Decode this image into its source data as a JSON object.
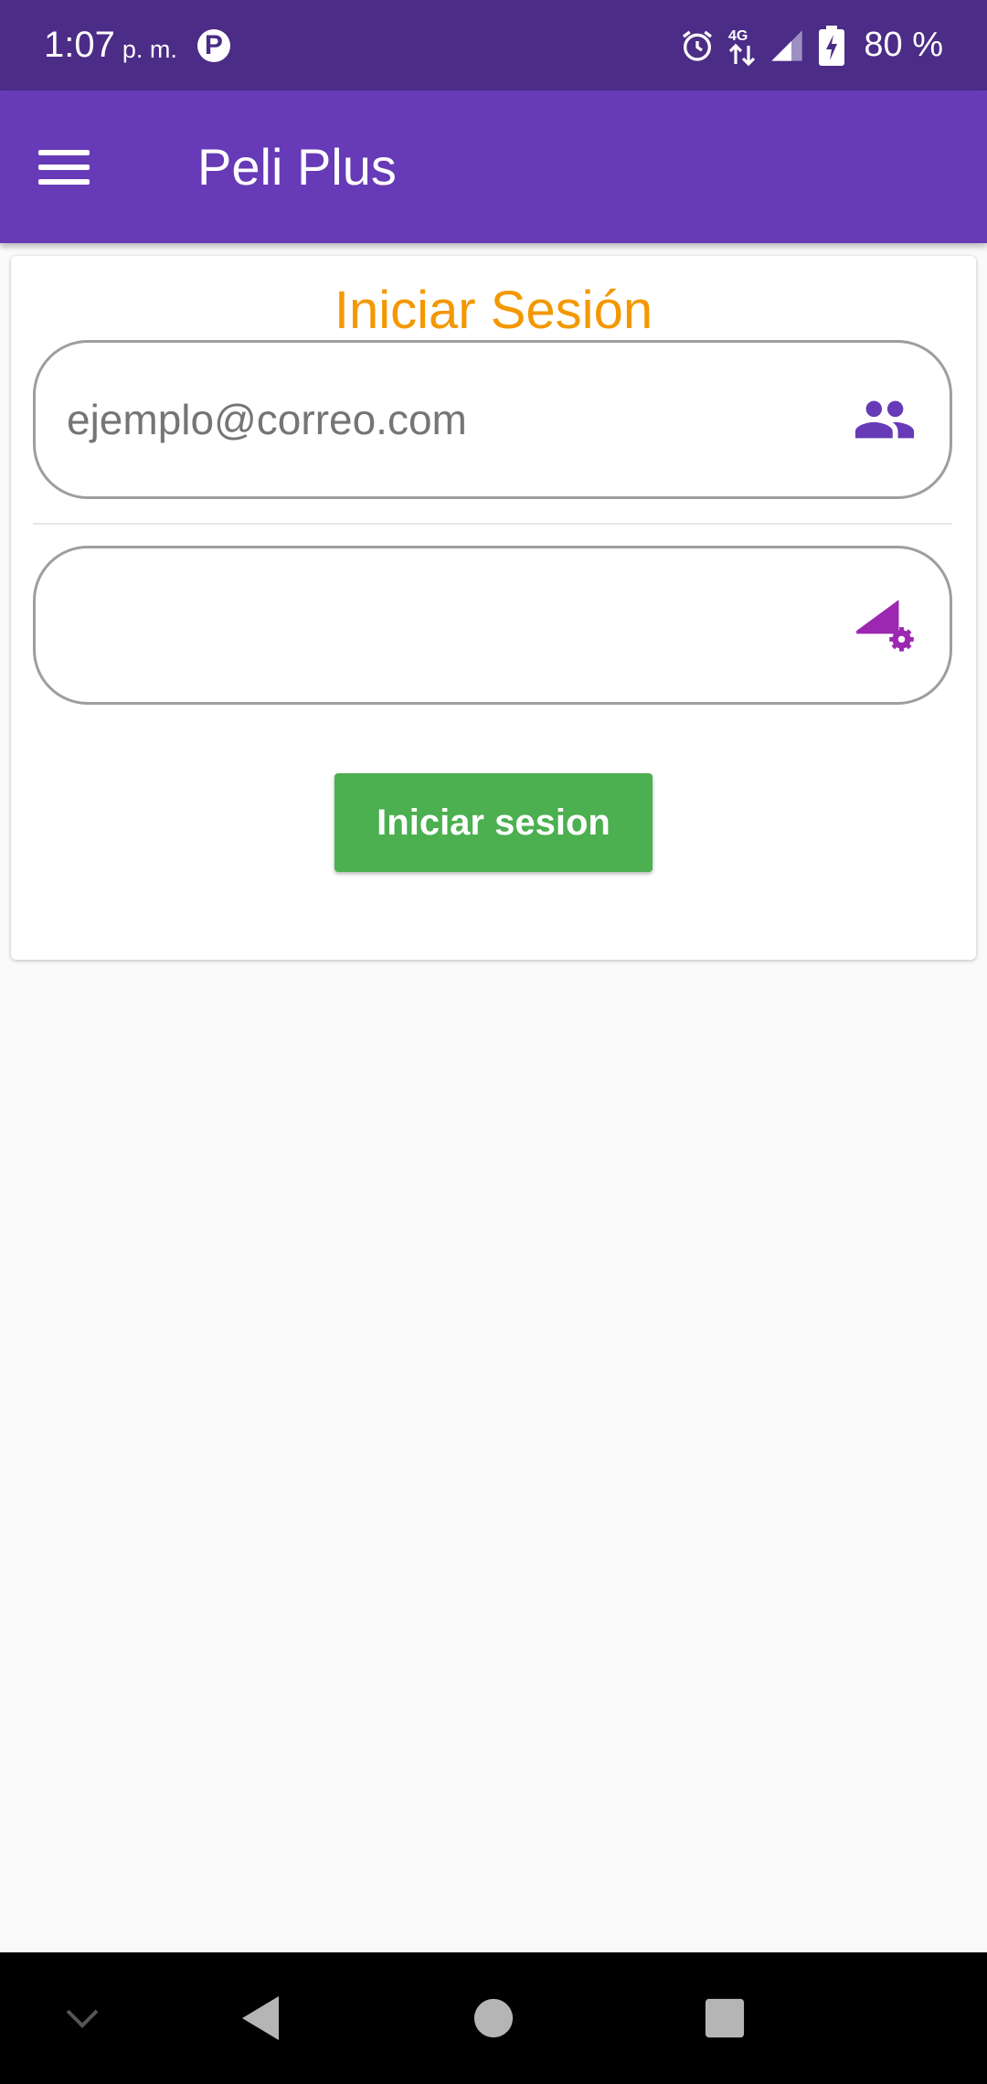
{
  "status_bar": {
    "time": "1:07",
    "ampm": "p. m.",
    "network": "4G",
    "battery": "80 %"
  },
  "app_bar": {
    "title": "Peli Plus"
  },
  "login": {
    "title": "Iniciar Sesión",
    "email_placeholder": "ejemplo@correo.com",
    "email_value": "",
    "password_value": "",
    "button_label": "Iniciar sesion"
  },
  "colors": {
    "status_bar": "#4b2c86",
    "app_bar": "#673ab7",
    "title_accent": "#f39800",
    "button": "#4caf50",
    "email_icon": "#673ab7",
    "password_icon": "#9c27b0"
  },
  "icons": {
    "email": "people-icon",
    "password": "signal-settings-icon"
  }
}
